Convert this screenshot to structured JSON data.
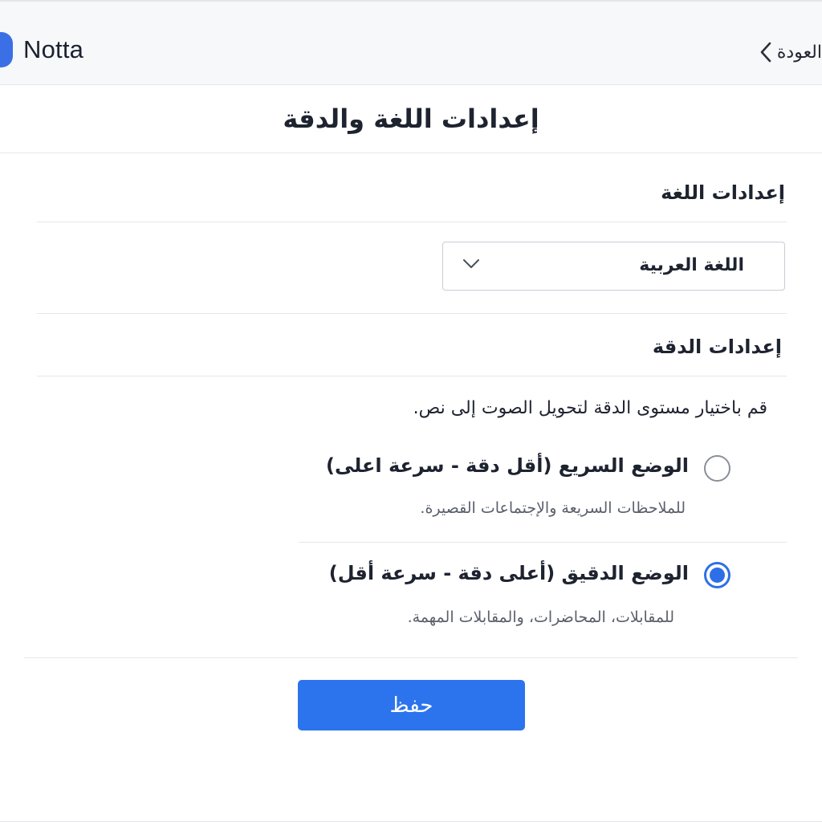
{
  "app": {
    "name": "Notta",
    "accent": "#2c74ee"
  },
  "header": {
    "back_label": "العودة",
    "back_icon": "chevron-left-icon"
  },
  "page": {
    "title": "إعدادات اللغة والدقة"
  },
  "language_section": {
    "heading": "إعدادات اللغة",
    "select": {
      "value": "اللغة العربية",
      "icon": "chevron-down-icon"
    }
  },
  "accuracy_section": {
    "heading": "إعدادات الدقة",
    "description": "قم باختيار مستوى الدقة لتحويل الصوت إلى نص.",
    "options": [
      {
        "label": "الوضع السريع (أقل دقة - سرعة اعلى)",
        "sub": "للملاحظات السريعة والإجتماعات القصيرة.",
        "selected": false
      },
      {
        "label": "الوضع الدقيق (أعلى دقة - سرعة أقل)",
        "sub": "للمقابلات، المحاضرات، والمقابلات المهمة.",
        "selected": true
      }
    ]
  },
  "actions": {
    "save_label": "حفظ"
  }
}
